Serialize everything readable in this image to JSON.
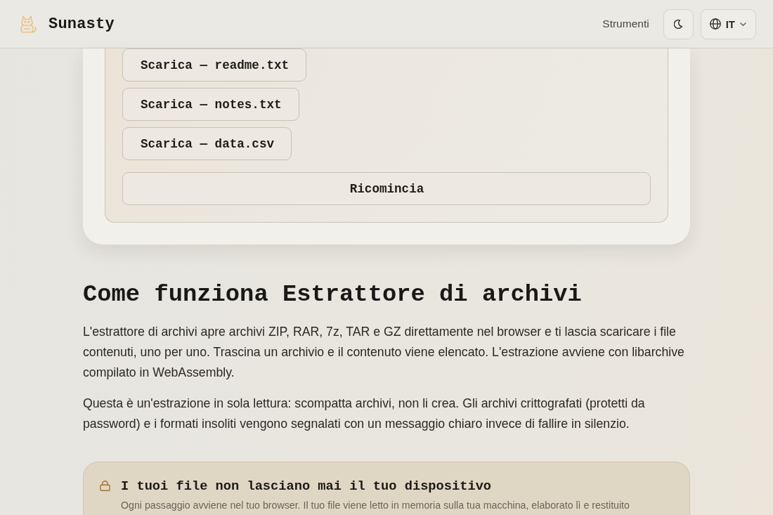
{
  "header": {
    "brand": "Sunasty",
    "nav_link": "Strumenti",
    "language": "IT"
  },
  "result_card": {
    "downloads": [
      {
        "label": "Scarica — readme.txt"
      },
      {
        "label": "Scarica — notes.txt"
      },
      {
        "label": "Scarica — data.csv"
      }
    ],
    "reset_button": "Ricomincia"
  },
  "section": {
    "title": "Come funziona Estrattore di archivi",
    "paragraphs": [
      "L'estrattore di archivi apre archivi ZIP, RAR, 7z, TAR e GZ direttamente nel browser e ti lascia scaricare i file contenuti, uno per uno. Trascina un archivio e il contenuto viene elencato. L'estrazione avviene con libarchive compilato in WebAssembly.",
      "Questa è un'estrazione in sola lettura: scompatta archivi, non li crea. Gli archivi crittografati (protetti da password) e i formati insoliti vengono segnalati con un messaggio chiaro invece di fallire in silenzio."
    ]
  },
  "privacy_note": {
    "title": "I tuoi file non lasciano mai il tuo dispositivo",
    "text": "Ogni passaggio avviene nel tuo browser. Il tuo file viene letto in memoria sulla tua macchina, elaborato lì e restituito"
  }
}
